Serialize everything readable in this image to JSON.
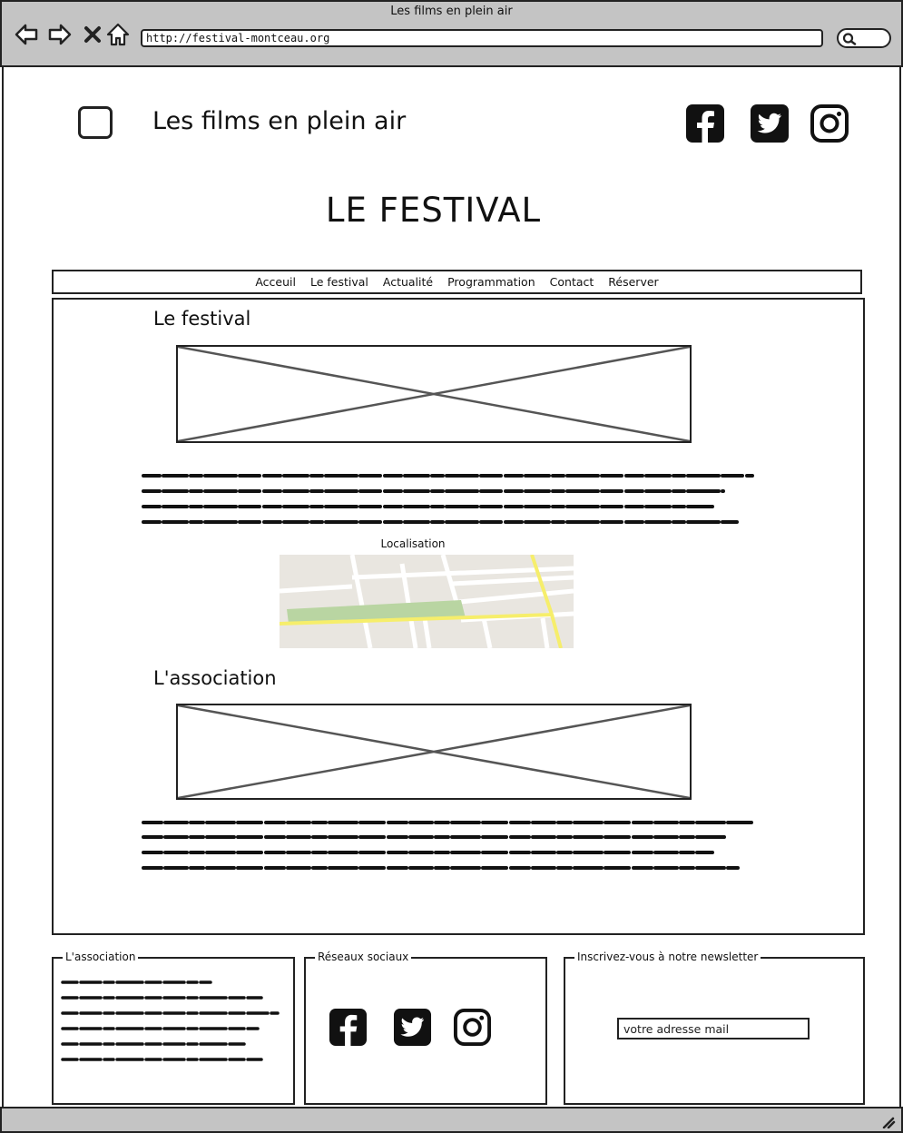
{
  "browser": {
    "window_title": "Les films en plein air",
    "url": "http://festival-montceau.org",
    "nav_icons": [
      "back-arrow-icon",
      "forward-arrow-icon",
      "close-x-icon",
      "home-icon"
    ],
    "search_icon": "search-icon"
  },
  "header": {
    "site_title": "Les films en plein air",
    "logo_icon": "logo-placeholder-icon",
    "social_icons": [
      "facebook-icon",
      "twitter-icon",
      "instagram-icon"
    ]
  },
  "page_heading": "LE FESTIVAL",
  "nav": {
    "items": [
      "Acceuil",
      "Le festival",
      "Actualité",
      "Programmation",
      "Contact",
      "Réserver"
    ]
  },
  "content": {
    "sections": [
      {
        "title": "Le festival"
      },
      {
        "title": "L'association"
      }
    ],
    "map_label": "Localisation"
  },
  "footer": {
    "association": {
      "legend": "L'association"
    },
    "social": {
      "legend": "Réseaux sociaux"
    },
    "newsletter": {
      "legend": "Inscrivez-vous à notre newsletter",
      "input_value": "votre adresse mail"
    }
  }
}
